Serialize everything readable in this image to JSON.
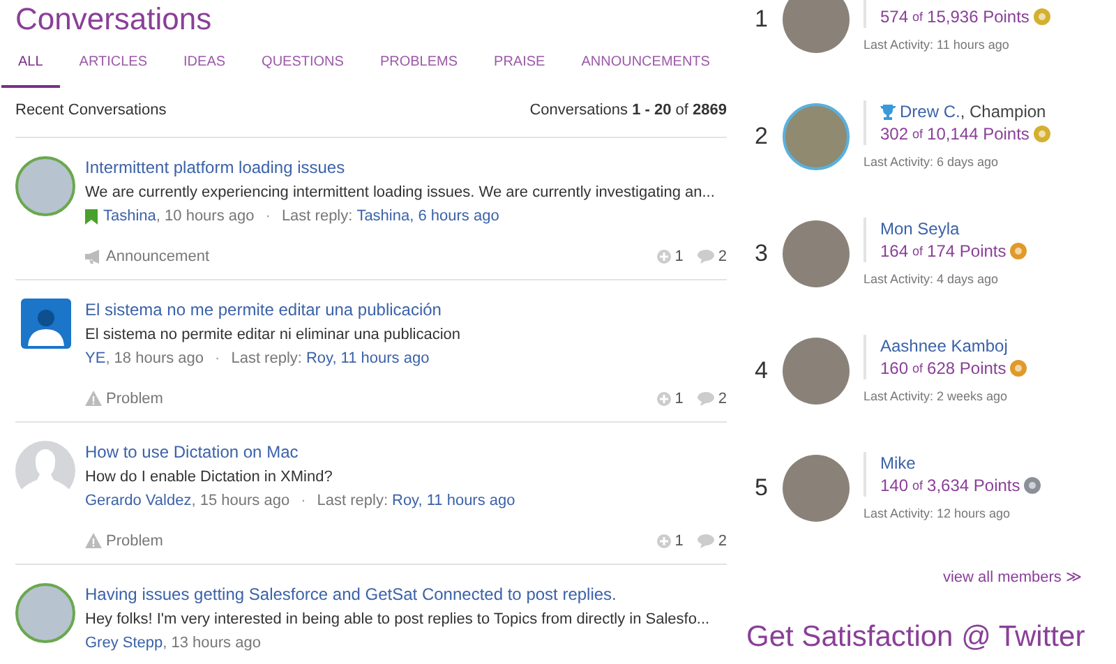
{
  "page_title": "Conversations",
  "tabs": [
    {
      "label": "ALL",
      "selected": true
    },
    {
      "label": "ARTICLES",
      "selected": false
    },
    {
      "label": "IDEAS",
      "selected": false
    },
    {
      "label": "QUESTIONS",
      "selected": false
    },
    {
      "label": "PROBLEMS",
      "selected": false
    },
    {
      "label": "PRAISE",
      "selected": false
    },
    {
      "label": "ANNOUNCEMENTS",
      "selected": false
    }
  ],
  "list_header": {
    "title": "Recent Conversations",
    "count": "Conversations **1 - 20** of **2869**"
  },
  "conversations": [
    {
      "avatar": {
        "kind": "photo"
      },
      "title": "Intermittent platform loading issues",
      "excerpt": "We are currently experiencing intermittent loading issues. We are currently investigating an...",
      "pinned": true,
      "author": "Tashina",
      "posted": ", 10 hours ago",
      "separator": "·",
      "last_reply_label": "Last reply:",
      "last_reply": "Tashina, 6 hours ago",
      "type": {
        "kind": "announcement",
        "label": "Announcement"
      },
      "votes": "1",
      "replies": "2"
    },
    {
      "avatar": {
        "kind": "icon"
      },
      "title": "El sistema no me permite editar una publicación",
      "excerpt": "El sistema no permite editar ni eliminar una publicacion",
      "pinned": false,
      "author": "YE",
      "posted": ", 18 hours ago",
      "separator": "·",
      "last_reply_label": "Last reply:",
      "last_reply": "Roy, 11 hours ago",
      "type": {
        "kind": "problem",
        "label": "Problem"
      },
      "votes": "1",
      "replies": "2"
    },
    {
      "avatar": {
        "kind": "silhouette"
      },
      "title": "How to use Dictation on Mac",
      "excerpt": "How do I enable Dictation in XMind?",
      "pinned": false,
      "author": "Gerardo Valdez",
      "posted": ", 15 hours ago",
      "separator": "·",
      "last_reply_label": "Last reply:",
      "last_reply": "Roy, 11 hours ago",
      "type": {
        "kind": "problem",
        "label": "Problem"
      },
      "votes": "1",
      "replies": "2"
    },
    {
      "avatar": {
        "kind": "photo"
      },
      "title": "Having issues getting Salesforce and GetSat Connected to post replies.",
      "excerpt": "Hey folks!   I'm very interested in being able to post replies to Topics from directly in Salesfo...",
      "pinned": false,
      "author": "Grey Stepp",
      "posted": ", 13 hours ago"
    }
  ],
  "members": [
    {
      "rank": "1",
      "points": "574",
      "of": "of",
      "total": "15,936 Points",
      "color": "#d4b030",
      "last_activity": "Last Activity: 11 hours ago"
    },
    {
      "rank": "2",
      "champion": true,
      "name": "Drew C.",
      "role": ", Champion",
      "points": "302",
      "of": "of",
      "total": "10,144 Points",
      "color": "#d4b030",
      "last_activity": "Last Activity: 6 days ago"
    },
    {
      "rank": "3",
      "champion": false,
      "name": "Mon Seyla",
      "points": "164",
      "of": "of",
      "total": "174 Points",
      "color": "#e09a2a",
      "last_activity": "Last Activity: 4 days ago"
    },
    {
      "rank": "4",
      "champion": false,
      "name": "Aashnee Kamboj",
      "points": "160",
      "of": "of",
      "total": "628 Points",
      "color": "#e09a2a",
      "last_activity": "Last Activity: 2 weeks ago"
    },
    {
      "rank": "5",
      "champion": false,
      "name": "Mike",
      "points": "140",
      "of": "of",
      "total": "3,634 Points",
      "color": "#8a9098",
      "last_activity": "Last Activity: 12 hours ago"
    }
  ],
  "view_all": "view all members ≫",
  "twitter_title": "Get Satisfaction @ Twitter"
}
